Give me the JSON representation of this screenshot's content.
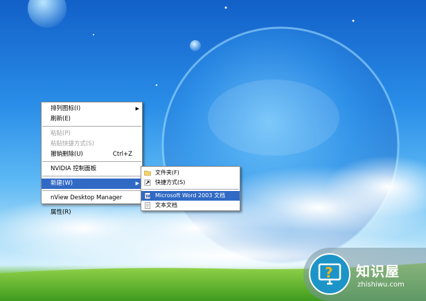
{
  "context_menu": {
    "items": [
      {
        "label": "排列图标(I)",
        "has_submenu": true
      },
      {
        "label": "刷新(E)"
      },
      {
        "label": "粘贴(P)",
        "disabled": true
      },
      {
        "label": "粘贴快捷方式(S)",
        "disabled": true
      },
      {
        "label": "撤销删除(U)",
        "shortcut": "Ctrl+Z"
      },
      {
        "label": "NVIDIA 控制面板"
      },
      {
        "label": "新建(W)",
        "has_submenu": true,
        "highlighted": true
      },
      {
        "label": "nView Desktop Manager"
      },
      {
        "label": "属性(R)"
      }
    ],
    "submenu_arrow": "▶"
  },
  "new_submenu": {
    "items": [
      {
        "label": "文件夹(F)",
        "icon": "folder-icon"
      },
      {
        "label": "快捷方式(S)",
        "icon": "shortcut-icon"
      },
      {
        "label": "Microsoft Word 2003 文档",
        "icon": "word-doc-icon",
        "highlighted": true
      },
      {
        "label": "文本文档",
        "icon": "text-doc-icon"
      }
    ]
  },
  "watermark": {
    "title": "知识屋",
    "url": "zhishiwu.com"
  },
  "colors": {
    "highlight": "#316ac5",
    "sky_top": "#1260c8",
    "grass": "#3f9b1e"
  }
}
